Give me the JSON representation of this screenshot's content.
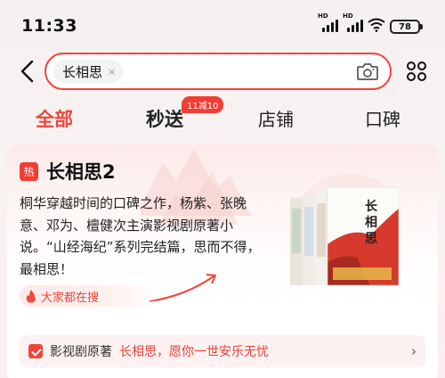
{
  "status_bar": {
    "time": "11:33",
    "hd_1": "HD",
    "hd_2": "HD",
    "battery": "78"
  },
  "search": {
    "query": "长相思",
    "clear_glyph": "×",
    "icons": [
      "back-arrow-icon",
      "camera-icon",
      "grid-menu-icon"
    ]
  },
  "tabs": {
    "all": "全部",
    "seckill": "秒送",
    "seckill_badge": "11减10",
    "shop": "店铺",
    "reviews": "口碑"
  },
  "card": {
    "hot_tag": "热",
    "title": "长相思2",
    "description": "桐华穿越时间的口碑之作，杨紫、张晚意、邓为、檀健次主演影视剧原著小说。“山经海纪”系列完结篇，思而不得，最相思！",
    "trend_label": "大家都在搜",
    "footer_label": "影视剧原著",
    "footer_text": "长相思，愿你一世安乐无忧",
    "footer_chevron": "›"
  },
  "colors": {
    "accent": "#f0453b",
    "badge": "#f23c34"
  }
}
